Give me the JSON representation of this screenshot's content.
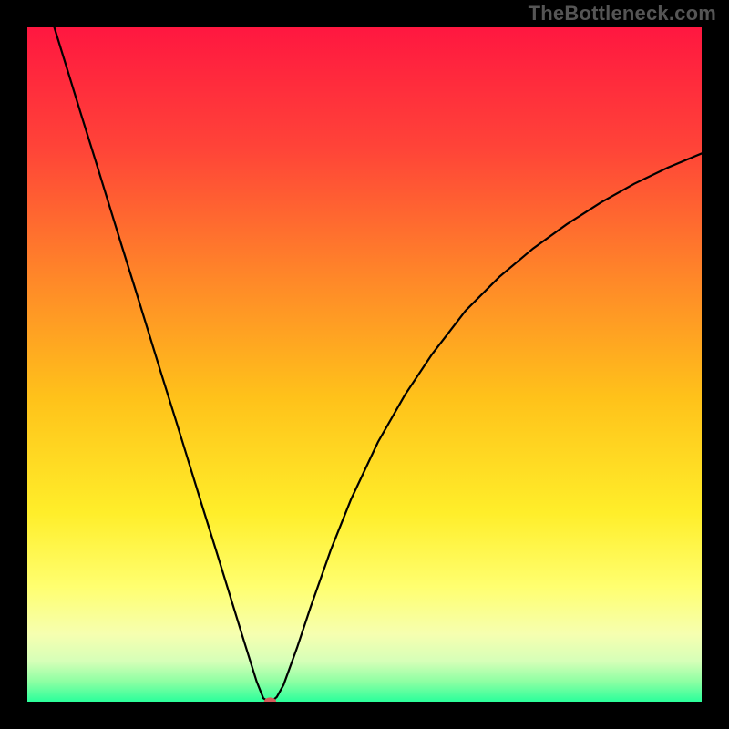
{
  "watermark": "TheBottleneck.com",
  "chart_data": {
    "type": "line",
    "title": "",
    "xlabel": "",
    "ylabel": "",
    "xlim": [
      0,
      100
    ],
    "ylim": [
      0,
      100
    ],
    "grid": false,
    "background_gradient_stops": [
      {
        "pos": 0.0,
        "color": "#ff1740"
      },
      {
        "pos": 0.18,
        "color": "#ff4438"
      },
      {
        "pos": 0.38,
        "color": "#ff8a28"
      },
      {
        "pos": 0.55,
        "color": "#ffc21a"
      },
      {
        "pos": 0.72,
        "color": "#ffee2a"
      },
      {
        "pos": 0.83,
        "color": "#ffff70"
      },
      {
        "pos": 0.9,
        "color": "#f6ffb0"
      },
      {
        "pos": 0.94,
        "color": "#d6ffb8"
      },
      {
        "pos": 0.97,
        "color": "#8effa3"
      },
      {
        "pos": 1.0,
        "color": "#2bff9b"
      }
    ],
    "series": [
      {
        "name": "left-branch",
        "x": [
          4,
          6,
          8,
          10,
          12,
          14,
          16,
          18,
          20,
          22,
          24,
          26,
          28,
          30,
          32,
          34,
          35,
          35.8
        ],
        "values": [
          100,
          93.5,
          87,
          80.6,
          74.1,
          67.6,
          61.2,
          54.7,
          48.2,
          41.8,
          35.3,
          28.8,
          22.4,
          15.9,
          9.4,
          3.0,
          0.5,
          0
        ]
      },
      {
        "name": "right-branch",
        "x": [
          36.2,
          37,
          38,
          40,
          42,
          45,
          48,
          52,
          56,
          60,
          65,
          70,
          75,
          80,
          85,
          90,
          95,
          100
        ],
        "values": [
          0,
          0.7,
          2.5,
          8,
          14,
          22.5,
          30,
          38.5,
          45.5,
          51.5,
          58,
          63,
          67.2,
          70.8,
          74,
          76.8,
          79.2,
          81.3
        ]
      }
    ],
    "marker": {
      "x": 36,
      "y": 0,
      "color": "#d65a5a",
      "radius_pct": 0.9
    }
  }
}
